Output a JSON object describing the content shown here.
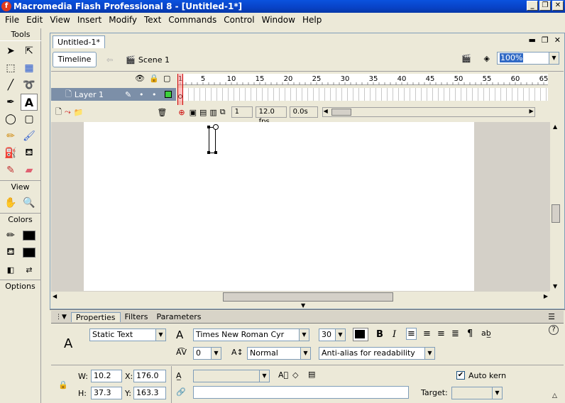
{
  "window": {
    "title": "Macromedia Flash Professional 8 - [Untitled-1*]"
  },
  "menu": [
    "File",
    "Edit",
    "View",
    "Insert",
    "Modify",
    "Text",
    "Commands",
    "Control",
    "Window",
    "Help"
  ],
  "tools": {
    "header": "Tools",
    "view_label": "View",
    "colors_label": "Colors",
    "options_label": "Options"
  },
  "document": {
    "tab": "Untitled-1*",
    "timeline_button": "Timeline",
    "scene": "Scene 1",
    "zoom": "100%"
  },
  "timeline": {
    "layer_name": "Layer 1",
    "frame_numbers": [
      "1",
      "5",
      "10",
      "15",
      "20",
      "25",
      "30",
      "35",
      "40",
      "45",
      "50",
      "55",
      "60",
      "65"
    ],
    "current_frame": "1",
    "fps": "12.0 fps",
    "time": "0.0s"
  },
  "properties": {
    "tabs": [
      "Properties",
      "Filters",
      "Parameters"
    ],
    "text_type": "Static Text",
    "font": "Times New Roman Cyr",
    "font_size": "30",
    "letter_spacing": "0",
    "baseline": "Normal",
    "antialias": "Anti-alias for readability",
    "w_label": "W:",
    "w_value": "10.2",
    "h_label": "H:",
    "h_value": "37.3",
    "x_label": "X:",
    "x_value": "176.0",
    "y_label": "Y:",
    "y_value": "163.3",
    "auto_kern": "Auto kern",
    "target_label": "Target:"
  },
  "colors": {
    "accent": "#0a52de",
    "stage": "#ffffff",
    "layer_row": "#7c8fa8"
  }
}
